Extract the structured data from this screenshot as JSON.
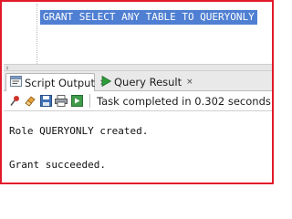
{
  "editor": {
    "sql_text": "GRANT SELECT ANY TABLE TO QUERYONLY"
  },
  "tabs": [
    {
      "label": "Script Output",
      "icon": "script-output-icon",
      "active": true,
      "close": "×"
    },
    {
      "label": "Query Result",
      "icon": "run-triangle-icon",
      "active": false,
      "close": "×"
    }
  ],
  "toolbar": {
    "buttons": [
      "pin-icon",
      "eraser-icon",
      "save-icon",
      "print-icon",
      "export-icon"
    ],
    "status": "Task completed in 0.302 seconds"
  },
  "output": {
    "lines": [
      "Role QUERYONLY created.",
      "Grant succeeded."
    ]
  },
  "colors": {
    "frame_border": "#e01a2b",
    "selection": "#4f7fd2",
    "run_icon": "#2e9c3c"
  }
}
